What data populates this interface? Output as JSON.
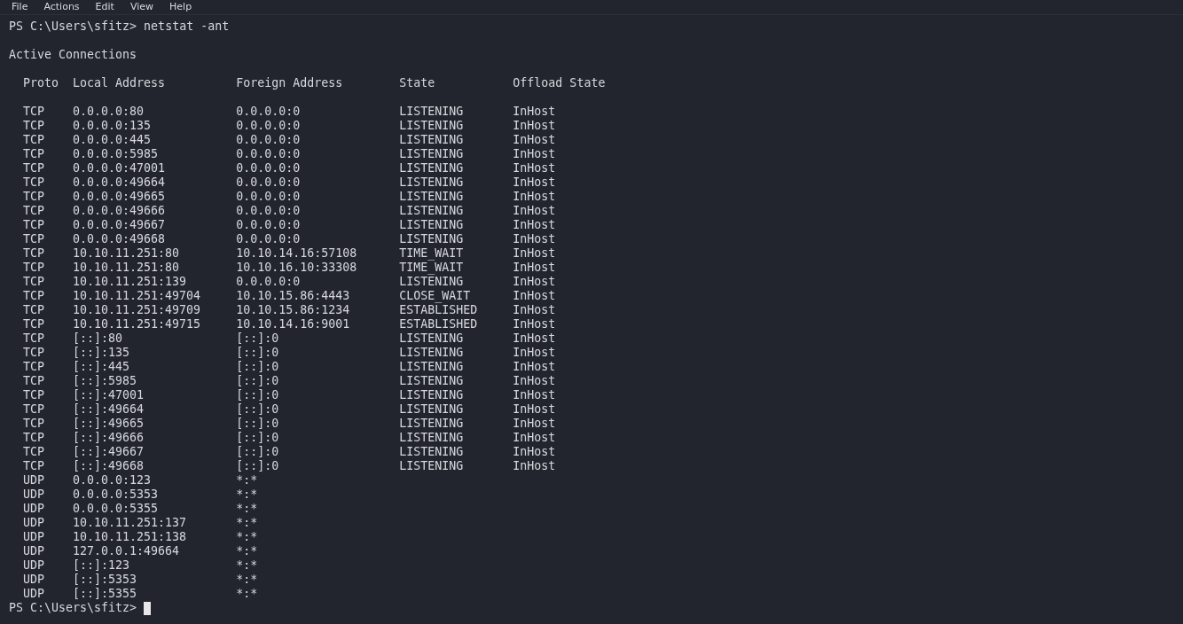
{
  "menu_bar": {
    "items": [
      "File",
      "Actions",
      "Edit",
      "View",
      "Help"
    ]
  },
  "terminal": {
    "command_line": {
      "prompt": "PS C:\\Users\\sfitz>",
      "command": "netstat -ant"
    },
    "heading": "Active Connections",
    "columns": [
      "Proto",
      "Local Address",
      "Foreign Address",
      "State",
      "Offload State"
    ],
    "rows": [
      {
        "proto": "TCP",
        "local_address": "0.0.0.0:80",
        "foreign_address": "0.0.0.0:0",
        "state": "LISTENING",
        "offload_state": "InHost"
      },
      {
        "proto": "TCP",
        "local_address": "0.0.0.0:135",
        "foreign_address": "0.0.0.0:0",
        "state": "LISTENING",
        "offload_state": "InHost"
      },
      {
        "proto": "TCP",
        "local_address": "0.0.0.0:445",
        "foreign_address": "0.0.0.0:0",
        "state": "LISTENING",
        "offload_state": "InHost"
      },
      {
        "proto": "TCP",
        "local_address": "0.0.0.0:5985",
        "foreign_address": "0.0.0.0:0",
        "state": "LISTENING",
        "offload_state": "InHost"
      },
      {
        "proto": "TCP",
        "local_address": "0.0.0.0:47001",
        "foreign_address": "0.0.0.0:0",
        "state": "LISTENING",
        "offload_state": "InHost"
      },
      {
        "proto": "TCP",
        "local_address": "0.0.0.0:49664",
        "foreign_address": "0.0.0.0:0",
        "state": "LISTENING",
        "offload_state": "InHost"
      },
      {
        "proto": "TCP",
        "local_address": "0.0.0.0:49665",
        "foreign_address": "0.0.0.0:0",
        "state": "LISTENING",
        "offload_state": "InHost"
      },
      {
        "proto": "TCP",
        "local_address": "0.0.0.0:49666",
        "foreign_address": "0.0.0.0:0",
        "state": "LISTENING",
        "offload_state": "InHost"
      },
      {
        "proto": "TCP",
        "local_address": "0.0.0.0:49667",
        "foreign_address": "0.0.0.0:0",
        "state": "LISTENING",
        "offload_state": "InHost"
      },
      {
        "proto": "TCP",
        "local_address": "0.0.0.0:49668",
        "foreign_address": "0.0.0.0:0",
        "state": "LISTENING",
        "offload_state": "InHost"
      },
      {
        "proto": "TCP",
        "local_address": "10.10.11.251:80",
        "foreign_address": "10.10.14.16:57108",
        "state": "TIME_WAIT",
        "offload_state": "InHost"
      },
      {
        "proto": "TCP",
        "local_address": "10.10.11.251:80",
        "foreign_address": "10.10.16.10:33308",
        "state": "TIME_WAIT",
        "offload_state": "InHost"
      },
      {
        "proto": "TCP",
        "local_address": "10.10.11.251:139",
        "foreign_address": "0.0.0.0:0",
        "state": "LISTENING",
        "offload_state": "InHost"
      },
      {
        "proto": "TCP",
        "local_address": "10.10.11.251:49704",
        "foreign_address": "10.10.15.86:4443",
        "state": "CLOSE_WAIT",
        "offload_state": "InHost"
      },
      {
        "proto": "TCP",
        "local_address": "10.10.11.251:49709",
        "foreign_address": "10.10.15.86:1234",
        "state": "ESTABLISHED",
        "offload_state": "InHost"
      },
      {
        "proto": "TCP",
        "local_address": "10.10.11.251:49715",
        "foreign_address": "10.10.14.16:9001",
        "state": "ESTABLISHED",
        "offload_state": "InHost"
      },
      {
        "proto": "TCP",
        "local_address": "[::]:80",
        "foreign_address": "[::]:0",
        "state": "LISTENING",
        "offload_state": "InHost"
      },
      {
        "proto": "TCP",
        "local_address": "[::]:135",
        "foreign_address": "[::]:0",
        "state": "LISTENING",
        "offload_state": "InHost"
      },
      {
        "proto": "TCP",
        "local_address": "[::]:445",
        "foreign_address": "[::]:0",
        "state": "LISTENING",
        "offload_state": "InHost"
      },
      {
        "proto": "TCP",
        "local_address": "[::]:5985",
        "foreign_address": "[::]:0",
        "state": "LISTENING",
        "offload_state": "InHost"
      },
      {
        "proto": "TCP",
        "local_address": "[::]:47001",
        "foreign_address": "[::]:0",
        "state": "LISTENING",
        "offload_state": "InHost"
      },
      {
        "proto": "TCP",
        "local_address": "[::]:49664",
        "foreign_address": "[::]:0",
        "state": "LISTENING",
        "offload_state": "InHost"
      },
      {
        "proto": "TCP",
        "local_address": "[::]:49665",
        "foreign_address": "[::]:0",
        "state": "LISTENING",
        "offload_state": "InHost"
      },
      {
        "proto": "TCP",
        "local_address": "[::]:49666",
        "foreign_address": "[::]:0",
        "state": "LISTENING",
        "offload_state": "InHost"
      },
      {
        "proto": "TCP",
        "local_address": "[::]:49667",
        "foreign_address": "[::]:0",
        "state": "LISTENING",
        "offload_state": "InHost"
      },
      {
        "proto": "TCP",
        "local_address": "[::]:49668",
        "foreign_address": "[::]:0",
        "state": "LISTENING",
        "offload_state": "InHost"
      },
      {
        "proto": "UDP",
        "local_address": "0.0.0.0:123",
        "foreign_address": "*:*"
      },
      {
        "proto": "UDP",
        "local_address": "0.0.0.0:5353",
        "foreign_address": "*:*"
      },
      {
        "proto": "UDP",
        "local_address": "0.0.0.0:5355",
        "foreign_address": "*:*"
      },
      {
        "proto": "UDP",
        "local_address": "10.10.11.251:137",
        "foreign_address": "*:*"
      },
      {
        "proto": "UDP",
        "local_address": "10.10.11.251:138",
        "foreign_address": "*:*"
      },
      {
        "proto": "UDP",
        "local_address": "127.0.0.1:49664",
        "foreign_address": "*:*"
      },
      {
        "proto": "UDP",
        "local_address": "[::]:123",
        "foreign_address": "*:*"
      },
      {
        "proto": "UDP",
        "local_address": "[::]:5353",
        "foreign_address": "*:*"
      },
      {
        "proto": "UDP",
        "local_address": "[::]:5355",
        "foreign_address": "*:*"
      }
    ],
    "input_line": {
      "prompt": "PS C:\\Users\\sfitz>"
    }
  }
}
